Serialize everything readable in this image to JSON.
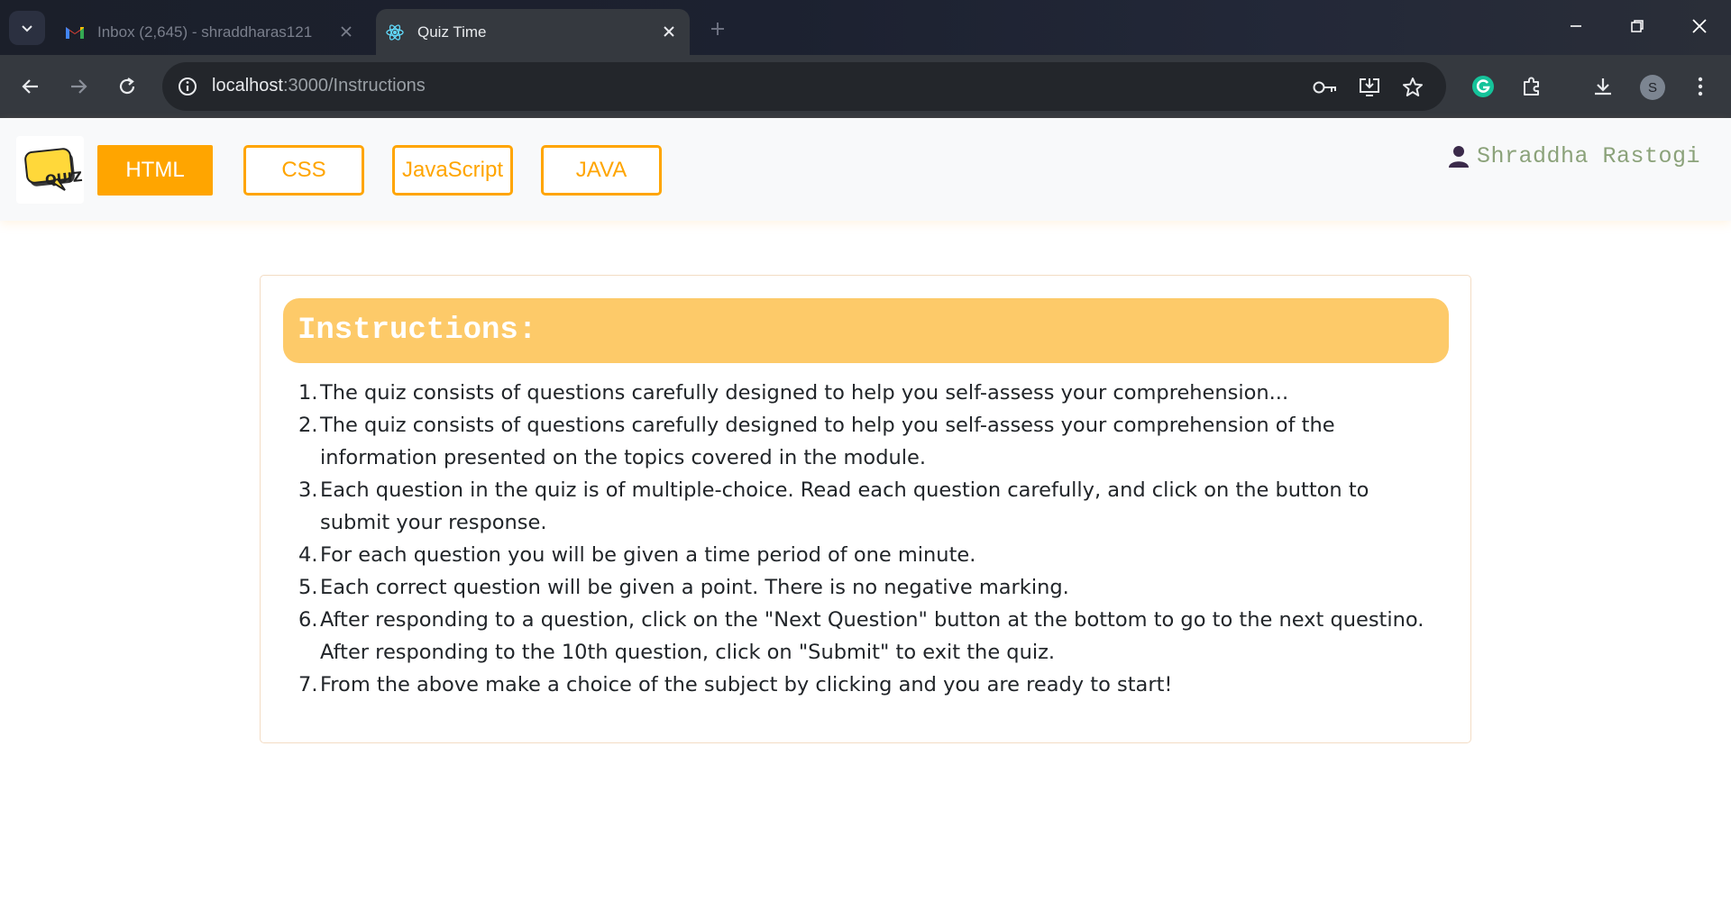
{
  "browser": {
    "tabs": [
      {
        "title": "Inbox (2,645) - shraddharas121",
        "favicon": "gmail-icon",
        "active": false
      },
      {
        "title": "Quiz Time",
        "favicon": "react-icon",
        "active": true
      }
    ],
    "url_host": "localhost",
    "url_path": ":3000/Instructions",
    "profile_initial": "S"
  },
  "nav": {
    "logo_text": "QUIZ",
    "subjects": [
      {
        "label": "HTML",
        "active": true
      },
      {
        "label": "CSS",
        "active": false
      },
      {
        "label": "JavaScript",
        "active": false
      },
      {
        "label": "JAVA",
        "active": false
      }
    ],
    "user_name": "Shraddha Rastogi"
  },
  "instructions": {
    "title": "Instructions:",
    "items": [
      {
        "num": "1.",
        "text": "The quiz consists of questions carefully designed to help you self-assess your comprehension..."
      },
      {
        "num": "2.",
        "text": "The quiz consists of questions carefully designed to help you self-assess your comprehension of the information presented on the topics covered in the module."
      },
      {
        "num": "3.",
        "text": "Each question in the quiz is of multiple-choice. Read each question carefully, and click on the button to submit your response."
      },
      {
        "num": "4.",
        "text": "For each question you will be given a time period of one minute."
      },
      {
        "num": "5.",
        "text": "Each correct question will be given a point. There is no negative marking."
      },
      {
        "num": "6.",
        "text": "After responding to a question, click on the \"Next Question\" button at the bottom to go to the next questino. After responding to the 10th question, click on \"Submit\" to exit the quiz."
      },
      {
        "num": "7.",
        "text": "From the above make a choice of the subject by clicking and you are ready to start!"
      }
    ]
  },
  "colors": {
    "accent": "#ffa500",
    "header_bg": "#fdca69",
    "user_name": "#8ba27a"
  }
}
